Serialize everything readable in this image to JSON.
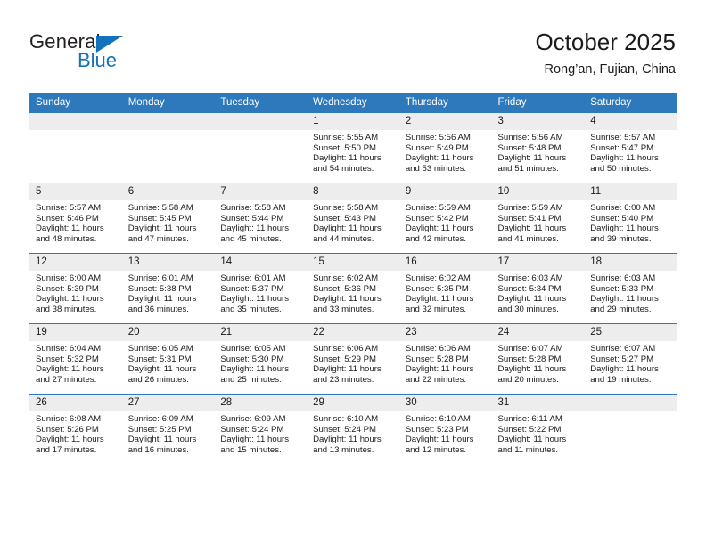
{
  "brand": {
    "name_dark": "General",
    "name_blue": "Blue",
    "triangle_icon": "triangle-icon",
    "accent_color": "#1272bb"
  },
  "header": {
    "title": "October 2025",
    "subtitle": "Rong’an, Fujian, China"
  },
  "theme": {
    "header_blue": "#2e78bc",
    "daynum_bg": "#ededed",
    "text": "#1a1a1a"
  },
  "weekdays": [
    "Sunday",
    "Monday",
    "Tuesday",
    "Wednesday",
    "Thursday",
    "Friday",
    "Saturday"
  ],
  "weeks": [
    [
      {
        "day": "",
        "lines": []
      },
      {
        "day": "",
        "lines": []
      },
      {
        "day": "",
        "lines": []
      },
      {
        "day": "1",
        "lines": [
          "Sunrise: 5:55 AM",
          "Sunset: 5:50 PM",
          "Daylight: 11 hours",
          "and 54 minutes."
        ]
      },
      {
        "day": "2",
        "lines": [
          "Sunrise: 5:56 AM",
          "Sunset: 5:49 PM",
          "Daylight: 11 hours",
          "and 53 minutes."
        ]
      },
      {
        "day": "3",
        "lines": [
          "Sunrise: 5:56 AM",
          "Sunset: 5:48 PM",
          "Daylight: 11 hours",
          "and 51 minutes."
        ]
      },
      {
        "day": "4",
        "lines": [
          "Sunrise: 5:57 AM",
          "Sunset: 5:47 PM",
          "Daylight: 11 hours",
          "and 50 minutes."
        ]
      }
    ],
    [
      {
        "day": "5",
        "lines": [
          "Sunrise: 5:57 AM",
          "Sunset: 5:46 PM",
          "Daylight: 11 hours",
          "and 48 minutes."
        ]
      },
      {
        "day": "6",
        "lines": [
          "Sunrise: 5:58 AM",
          "Sunset: 5:45 PM",
          "Daylight: 11 hours",
          "and 47 minutes."
        ]
      },
      {
        "day": "7",
        "lines": [
          "Sunrise: 5:58 AM",
          "Sunset: 5:44 PM",
          "Daylight: 11 hours",
          "and 45 minutes."
        ]
      },
      {
        "day": "8",
        "lines": [
          "Sunrise: 5:58 AM",
          "Sunset: 5:43 PM",
          "Daylight: 11 hours",
          "and 44 minutes."
        ]
      },
      {
        "day": "9",
        "lines": [
          "Sunrise: 5:59 AM",
          "Sunset: 5:42 PM",
          "Daylight: 11 hours",
          "and 42 minutes."
        ]
      },
      {
        "day": "10",
        "lines": [
          "Sunrise: 5:59 AM",
          "Sunset: 5:41 PM",
          "Daylight: 11 hours",
          "and 41 minutes."
        ]
      },
      {
        "day": "11",
        "lines": [
          "Sunrise: 6:00 AM",
          "Sunset: 5:40 PM",
          "Daylight: 11 hours",
          "and 39 minutes."
        ]
      }
    ],
    [
      {
        "day": "12",
        "lines": [
          "Sunrise: 6:00 AM",
          "Sunset: 5:39 PM",
          "Daylight: 11 hours",
          "and 38 minutes."
        ]
      },
      {
        "day": "13",
        "lines": [
          "Sunrise: 6:01 AM",
          "Sunset: 5:38 PM",
          "Daylight: 11 hours",
          "and 36 minutes."
        ]
      },
      {
        "day": "14",
        "lines": [
          "Sunrise: 6:01 AM",
          "Sunset: 5:37 PM",
          "Daylight: 11 hours",
          "and 35 minutes."
        ]
      },
      {
        "day": "15",
        "lines": [
          "Sunrise: 6:02 AM",
          "Sunset: 5:36 PM",
          "Daylight: 11 hours",
          "and 33 minutes."
        ]
      },
      {
        "day": "16",
        "lines": [
          "Sunrise: 6:02 AM",
          "Sunset: 5:35 PM",
          "Daylight: 11 hours",
          "and 32 minutes."
        ]
      },
      {
        "day": "17",
        "lines": [
          "Sunrise: 6:03 AM",
          "Sunset: 5:34 PM",
          "Daylight: 11 hours",
          "and 30 minutes."
        ]
      },
      {
        "day": "18",
        "lines": [
          "Sunrise: 6:03 AM",
          "Sunset: 5:33 PM",
          "Daylight: 11 hours",
          "and 29 minutes."
        ]
      }
    ],
    [
      {
        "day": "19",
        "lines": [
          "Sunrise: 6:04 AM",
          "Sunset: 5:32 PM",
          "Daylight: 11 hours",
          "and 27 minutes."
        ]
      },
      {
        "day": "20",
        "lines": [
          "Sunrise: 6:05 AM",
          "Sunset: 5:31 PM",
          "Daylight: 11 hours",
          "and 26 minutes."
        ]
      },
      {
        "day": "21",
        "lines": [
          "Sunrise: 6:05 AM",
          "Sunset: 5:30 PM",
          "Daylight: 11 hours",
          "and 25 minutes."
        ]
      },
      {
        "day": "22",
        "lines": [
          "Sunrise: 6:06 AM",
          "Sunset: 5:29 PM",
          "Daylight: 11 hours",
          "and 23 minutes."
        ]
      },
      {
        "day": "23",
        "lines": [
          "Sunrise: 6:06 AM",
          "Sunset: 5:28 PM",
          "Daylight: 11 hours",
          "and 22 minutes."
        ]
      },
      {
        "day": "24",
        "lines": [
          "Sunrise: 6:07 AM",
          "Sunset: 5:28 PM",
          "Daylight: 11 hours",
          "and 20 minutes."
        ]
      },
      {
        "day": "25",
        "lines": [
          "Sunrise: 6:07 AM",
          "Sunset: 5:27 PM",
          "Daylight: 11 hours",
          "and 19 minutes."
        ]
      }
    ],
    [
      {
        "day": "26",
        "lines": [
          "Sunrise: 6:08 AM",
          "Sunset: 5:26 PM",
          "Daylight: 11 hours",
          "and 17 minutes."
        ]
      },
      {
        "day": "27",
        "lines": [
          "Sunrise: 6:09 AM",
          "Sunset: 5:25 PM",
          "Daylight: 11 hours",
          "and 16 minutes."
        ]
      },
      {
        "day": "28",
        "lines": [
          "Sunrise: 6:09 AM",
          "Sunset: 5:24 PM",
          "Daylight: 11 hours",
          "and 15 minutes."
        ]
      },
      {
        "day": "29",
        "lines": [
          "Sunrise: 6:10 AM",
          "Sunset: 5:24 PM",
          "Daylight: 11 hours",
          "and 13 minutes."
        ]
      },
      {
        "day": "30",
        "lines": [
          "Sunrise: 6:10 AM",
          "Sunset: 5:23 PM",
          "Daylight: 11 hours",
          "and 12 minutes."
        ]
      },
      {
        "day": "31",
        "lines": [
          "Sunrise: 6:11 AM",
          "Sunset: 5:22 PM",
          "Daylight: 11 hours",
          "and 11 minutes."
        ]
      },
      {
        "day": "",
        "lines": []
      }
    ]
  ]
}
